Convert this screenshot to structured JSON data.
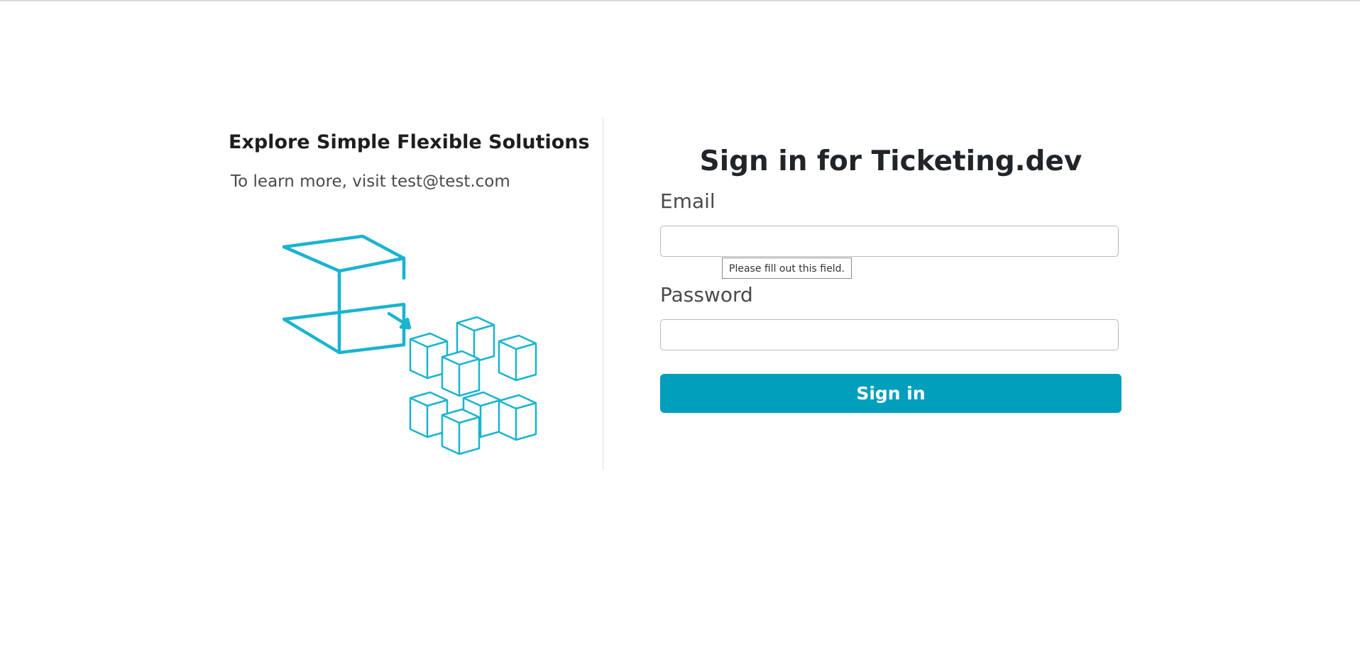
{
  "promo": {
    "title": "Explore Simple Flexible Solutions",
    "subtitle": "To learn more, visit test@test.com",
    "illustration": "cubes-illustration"
  },
  "form": {
    "title": "Sign in for Ticketing.dev",
    "email": {
      "label": "Email",
      "value": "",
      "placeholder": ""
    },
    "password": {
      "label": "Password",
      "value": "",
      "placeholder": ""
    },
    "validation_tooltip": "Please fill out this field.",
    "submit_label": "Sign in"
  },
  "colors": {
    "accent": "#029fbc",
    "illustration": "#19b4cf",
    "text": "#212529",
    "muted_text": "#4a4a4a"
  }
}
